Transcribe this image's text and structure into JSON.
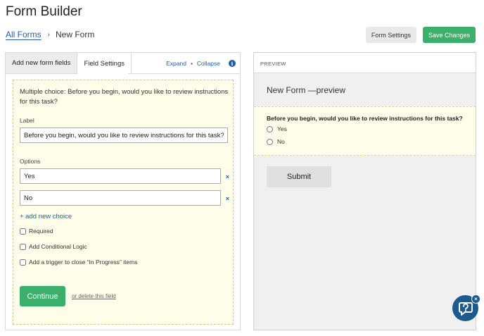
{
  "header": {
    "title": "Form Builder",
    "breadcrumb_link": "All Forms",
    "breadcrumb_sep": "›",
    "breadcrumb_current": "New Form",
    "form_settings_label": "Form Settings",
    "save_label": "Save Changes"
  },
  "left": {
    "tabs": [
      {
        "label": "Add new form fields",
        "active": false
      },
      {
        "label": "Field Settings",
        "active": true
      }
    ],
    "expand_label": "Expand",
    "dot": "•",
    "collapse_label": "Collapse",
    "info_glyph": "i",
    "field": {
      "heading": "Multiple choice: Before you begin, would you like to review instructions for this task?",
      "label_caption": "Label",
      "label_value": "Before you begin, would you like to review instructions for this task?",
      "options_caption": "Options",
      "options": [
        {
          "value": "Yes",
          "remove": "×"
        },
        {
          "value": "No",
          "remove": "×"
        }
      ],
      "add_choice": "+ add new choice",
      "checkboxes": [
        {
          "label": "Required",
          "checked": false
        },
        {
          "label": "Add Conditional Logic",
          "checked": false
        },
        {
          "label": "Add a trigger to close “In Progress” items",
          "checked": false
        }
      ],
      "continue_label": "Continue",
      "delete_label": "or delete this field"
    }
  },
  "preview": {
    "header": "PREVIEW",
    "title": "New Form —preview",
    "question": "Before you begin, would you like to review instructions for this task?",
    "choices": [
      "Yes",
      "No"
    ],
    "submit_label": "Submit"
  },
  "help_widget": {
    "icon": "chat-help-icon",
    "close_glyph": "×",
    "color": "#1e5a8c"
  },
  "colors": {
    "accent_green": "#3cb06b",
    "link_blue": "#1f5fa8",
    "highlight_yellow": "#fdfde9"
  }
}
